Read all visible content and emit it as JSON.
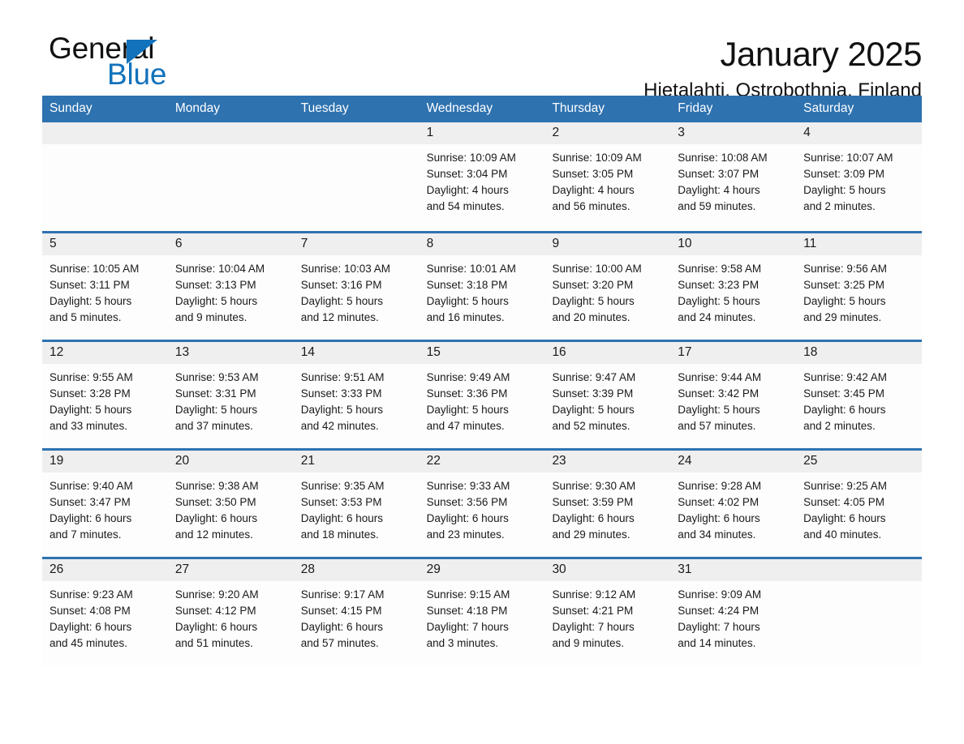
{
  "brand": {
    "name_part1": "General",
    "name_part2": "Blue",
    "triangle_color": "#1272bb",
    "icon": "general-blue-logo"
  },
  "header": {
    "title": "January 2025",
    "subtitle": "Hietalahti, Ostrobothnia, Finland"
  },
  "colors": {
    "header_blue": "#2e72b0",
    "day_band_gray": "#efefef",
    "text": "#1a1a1a",
    "brand_blue": "#1272bb"
  },
  "weekdays": [
    "Sunday",
    "Monday",
    "Tuesday",
    "Wednesday",
    "Thursday",
    "Friday",
    "Saturday"
  ],
  "weeks": [
    [
      {
        "day": "",
        "empty": true
      },
      {
        "day": "",
        "empty": true
      },
      {
        "day": "",
        "empty": true
      },
      {
        "day": "1",
        "sunrise": "Sunrise: 10:09 AM",
        "sunset": "Sunset: 3:04 PM",
        "daylight_1": "Daylight: 4 hours",
        "daylight_2": "and 54 minutes."
      },
      {
        "day": "2",
        "sunrise": "Sunrise: 10:09 AM",
        "sunset": "Sunset: 3:05 PM",
        "daylight_1": "Daylight: 4 hours",
        "daylight_2": "and 56 minutes."
      },
      {
        "day": "3",
        "sunrise": "Sunrise: 10:08 AM",
        "sunset": "Sunset: 3:07 PM",
        "daylight_1": "Daylight: 4 hours",
        "daylight_2": "and 59 minutes."
      },
      {
        "day": "4",
        "sunrise": "Sunrise: 10:07 AM",
        "sunset": "Sunset: 3:09 PM",
        "daylight_1": "Daylight: 5 hours",
        "daylight_2": "and 2 minutes."
      }
    ],
    [
      {
        "day": "5",
        "sunrise": "Sunrise: 10:05 AM",
        "sunset": "Sunset: 3:11 PM",
        "daylight_1": "Daylight: 5 hours",
        "daylight_2": "and 5 minutes."
      },
      {
        "day": "6",
        "sunrise": "Sunrise: 10:04 AM",
        "sunset": "Sunset: 3:13 PM",
        "daylight_1": "Daylight: 5 hours",
        "daylight_2": "and 9 minutes."
      },
      {
        "day": "7",
        "sunrise": "Sunrise: 10:03 AM",
        "sunset": "Sunset: 3:16 PM",
        "daylight_1": "Daylight: 5 hours",
        "daylight_2": "and 12 minutes."
      },
      {
        "day": "8",
        "sunrise": "Sunrise: 10:01 AM",
        "sunset": "Sunset: 3:18 PM",
        "daylight_1": "Daylight: 5 hours",
        "daylight_2": "and 16 minutes."
      },
      {
        "day": "9",
        "sunrise": "Sunrise: 10:00 AM",
        "sunset": "Sunset: 3:20 PM",
        "daylight_1": "Daylight: 5 hours",
        "daylight_2": "and 20 minutes."
      },
      {
        "day": "10",
        "sunrise": "Sunrise: 9:58 AM",
        "sunset": "Sunset: 3:23 PM",
        "daylight_1": "Daylight: 5 hours",
        "daylight_2": "and 24 minutes."
      },
      {
        "day": "11",
        "sunrise": "Sunrise: 9:56 AM",
        "sunset": "Sunset: 3:25 PM",
        "daylight_1": "Daylight: 5 hours",
        "daylight_2": "and 29 minutes."
      }
    ],
    [
      {
        "day": "12",
        "sunrise": "Sunrise: 9:55 AM",
        "sunset": "Sunset: 3:28 PM",
        "daylight_1": "Daylight: 5 hours",
        "daylight_2": "and 33 minutes."
      },
      {
        "day": "13",
        "sunrise": "Sunrise: 9:53 AM",
        "sunset": "Sunset: 3:31 PM",
        "daylight_1": "Daylight: 5 hours",
        "daylight_2": "and 37 minutes."
      },
      {
        "day": "14",
        "sunrise": "Sunrise: 9:51 AM",
        "sunset": "Sunset: 3:33 PM",
        "daylight_1": "Daylight: 5 hours",
        "daylight_2": "and 42 minutes."
      },
      {
        "day": "15",
        "sunrise": "Sunrise: 9:49 AM",
        "sunset": "Sunset: 3:36 PM",
        "daylight_1": "Daylight: 5 hours",
        "daylight_2": "and 47 minutes."
      },
      {
        "day": "16",
        "sunrise": "Sunrise: 9:47 AM",
        "sunset": "Sunset: 3:39 PM",
        "daylight_1": "Daylight: 5 hours",
        "daylight_2": "and 52 minutes."
      },
      {
        "day": "17",
        "sunrise": "Sunrise: 9:44 AM",
        "sunset": "Sunset: 3:42 PM",
        "daylight_1": "Daylight: 5 hours",
        "daylight_2": "and 57 minutes."
      },
      {
        "day": "18",
        "sunrise": "Sunrise: 9:42 AM",
        "sunset": "Sunset: 3:45 PM",
        "daylight_1": "Daylight: 6 hours",
        "daylight_2": "and 2 minutes."
      }
    ],
    [
      {
        "day": "19",
        "sunrise": "Sunrise: 9:40 AM",
        "sunset": "Sunset: 3:47 PM",
        "daylight_1": "Daylight: 6 hours",
        "daylight_2": "and 7 minutes."
      },
      {
        "day": "20",
        "sunrise": "Sunrise: 9:38 AM",
        "sunset": "Sunset: 3:50 PM",
        "daylight_1": "Daylight: 6 hours",
        "daylight_2": "and 12 minutes."
      },
      {
        "day": "21",
        "sunrise": "Sunrise: 9:35 AM",
        "sunset": "Sunset: 3:53 PM",
        "daylight_1": "Daylight: 6 hours",
        "daylight_2": "and 18 minutes."
      },
      {
        "day": "22",
        "sunrise": "Sunrise: 9:33 AM",
        "sunset": "Sunset: 3:56 PM",
        "daylight_1": "Daylight: 6 hours",
        "daylight_2": "and 23 minutes."
      },
      {
        "day": "23",
        "sunrise": "Sunrise: 9:30 AM",
        "sunset": "Sunset: 3:59 PM",
        "daylight_1": "Daylight: 6 hours",
        "daylight_2": "and 29 minutes."
      },
      {
        "day": "24",
        "sunrise": "Sunrise: 9:28 AM",
        "sunset": "Sunset: 4:02 PM",
        "daylight_1": "Daylight: 6 hours",
        "daylight_2": "and 34 minutes."
      },
      {
        "day": "25",
        "sunrise": "Sunrise: 9:25 AM",
        "sunset": "Sunset: 4:05 PM",
        "daylight_1": "Daylight: 6 hours",
        "daylight_2": "and 40 minutes."
      }
    ],
    [
      {
        "day": "26",
        "sunrise": "Sunrise: 9:23 AM",
        "sunset": "Sunset: 4:08 PM",
        "daylight_1": "Daylight: 6 hours",
        "daylight_2": "and 45 minutes."
      },
      {
        "day": "27",
        "sunrise": "Sunrise: 9:20 AM",
        "sunset": "Sunset: 4:12 PM",
        "daylight_1": "Daylight: 6 hours",
        "daylight_2": "and 51 minutes."
      },
      {
        "day": "28",
        "sunrise": "Sunrise: 9:17 AM",
        "sunset": "Sunset: 4:15 PM",
        "daylight_1": "Daylight: 6 hours",
        "daylight_2": "and 57 minutes."
      },
      {
        "day": "29",
        "sunrise": "Sunrise: 9:15 AM",
        "sunset": "Sunset: 4:18 PM",
        "daylight_1": "Daylight: 7 hours",
        "daylight_2": "and 3 minutes."
      },
      {
        "day": "30",
        "sunrise": "Sunrise: 9:12 AM",
        "sunset": "Sunset: 4:21 PM",
        "daylight_1": "Daylight: 7 hours",
        "daylight_2": "and 9 minutes."
      },
      {
        "day": "31",
        "sunrise": "Sunrise: 9:09 AM",
        "sunset": "Sunset: 4:24 PM",
        "daylight_1": "Daylight: 7 hours",
        "daylight_2": "and 14 minutes."
      },
      {
        "day": "",
        "empty": true
      }
    ]
  ]
}
